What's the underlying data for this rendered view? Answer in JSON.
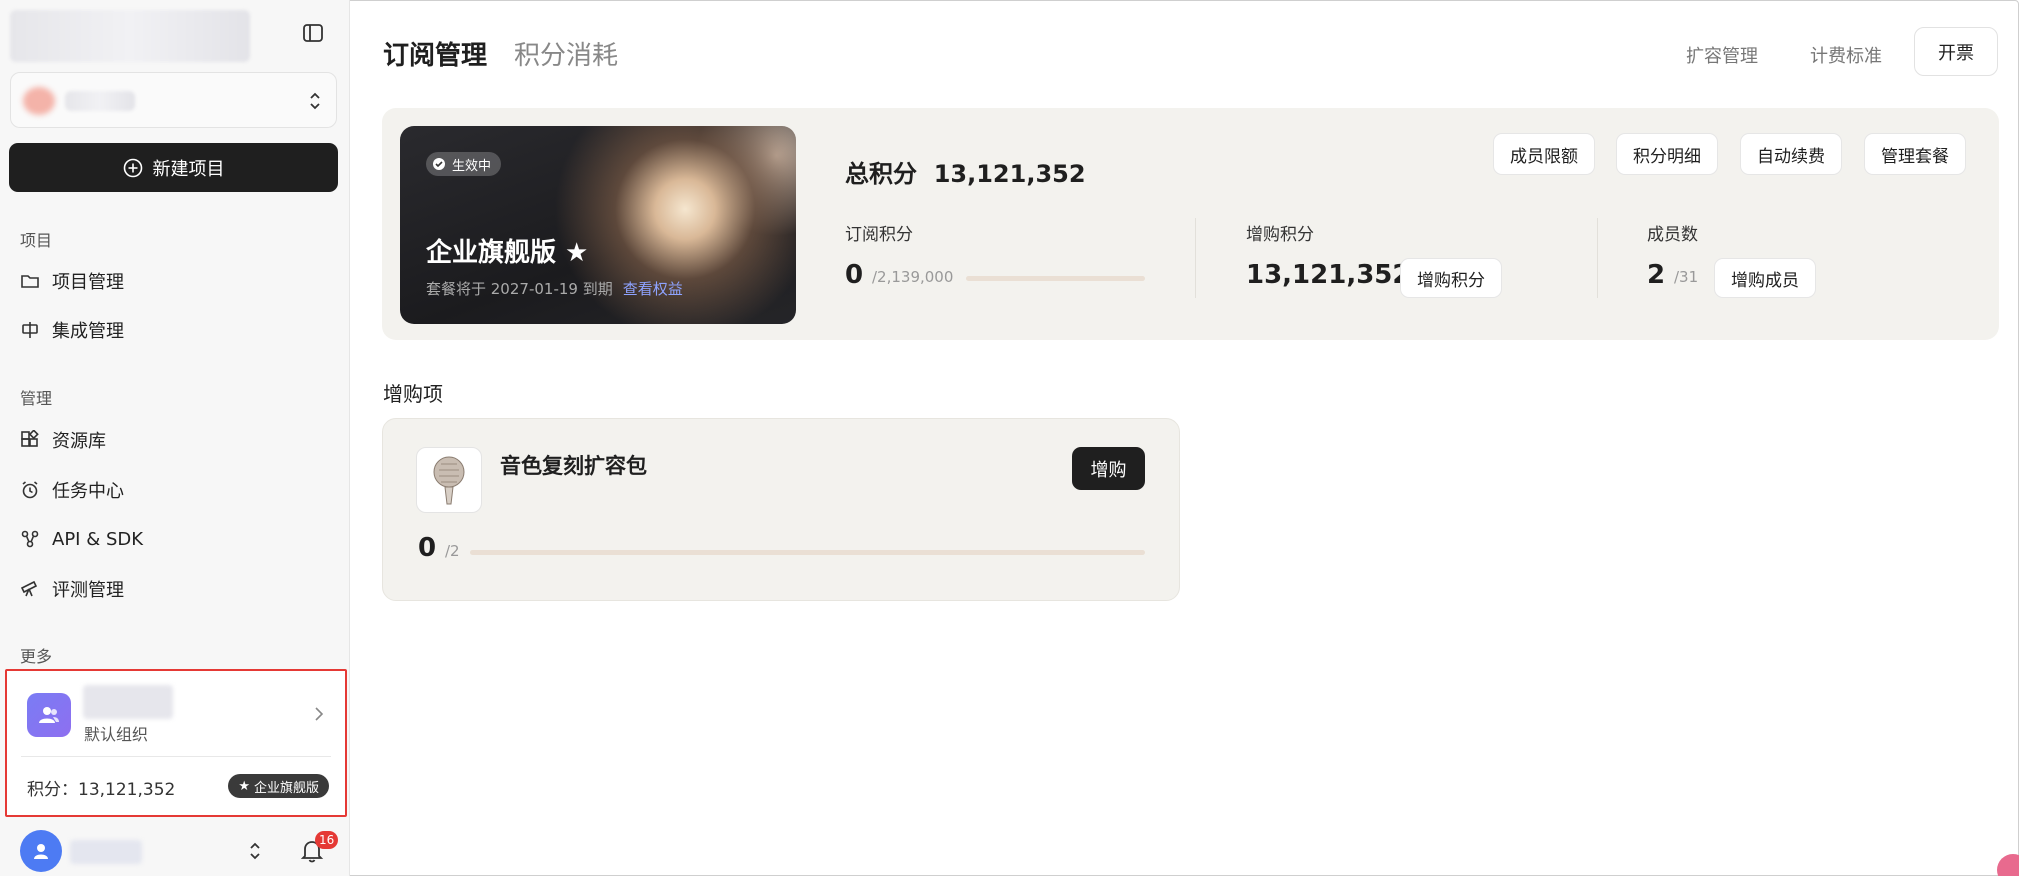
{
  "sidebar": {
    "new_project": "新建项目",
    "section_project": "项目",
    "project_items": [
      {
        "label": "项目管理",
        "icon": "folder-icon"
      },
      {
        "label": "集成管理",
        "icon": "integration-icon"
      }
    ],
    "section_manage": "管理",
    "manage_items": [
      {
        "label": "资源库",
        "icon": "apps-icon"
      },
      {
        "label": "任务中心",
        "icon": "alarm-icon"
      },
      {
        "label": "API & SDK",
        "icon": "api-icon"
      },
      {
        "label": "评测管理",
        "icon": "telescope-icon"
      }
    ],
    "section_more": "更多",
    "org": {
      "subtitle": "默认组织",
      "points": "积分：13,121,352",
      "badge": "企业旗舰版"
    },
    "notification_count": "16"
  },
  "header": {
    "tabs": [
      {
        "label": "订阅管理",
        "active": true
      },
      {
        "label": "积分消耗",
        "active": false
      }
    ],
    "links": [
      "扩容管理",
      "计费标准"
    ],
    "invoice": "开票"
  },
  "plan": {
    "status": "生效中",
    "name": "企业旗舰版 ★",
    "expire": "套餐将于 2027-01-19 到期",
    "benefits_link": "查看权益",
    "total_label": "总积分",
    "total_value": "13,121,352",
    "actions": [
      "成员限额",
      "积分明细",
      "自动续费",
      "管理套餐"
    ],
    "subscription": {
      "label": "订阅积分",
      "value": "0",
      "of": "/2,139,000",
      "used_fraction": 0
    },
    "purchased": {
      "label": "增购积分",
      "value": "13,121,352",
      "button": "增购积分"
    },
    "members": {
      "label": "成员数",
      "value": "2",
      "of": "/31",
      "button": "增购成员"
    }
  },
  "addons": {
    "title": "增购项",
    "items": [
      {
        "name": "音色复刻扩容包",
        "button": "增购",
        "value": "0",
        "of": "/2",
        "used_fraction": 0
      }
    ]
  },
  "colors": {
    "accent_dark": "#1f1f1f",
    "alert_red": "#e53935",
    "link_blue": "#8ea3ff",
    "org_icon": "#7a7cf4"
  }
}
